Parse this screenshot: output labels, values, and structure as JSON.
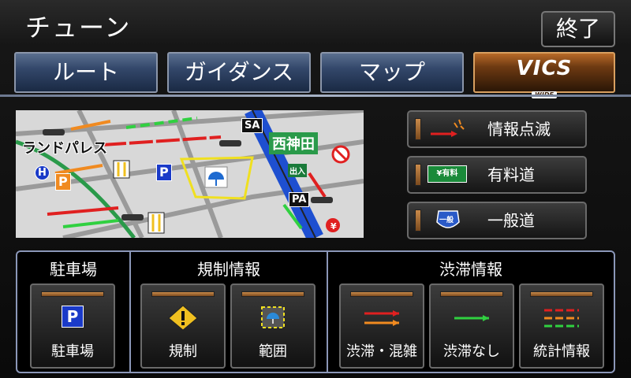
{
  "header": {
    "title": "チューン",
    "exit_label": "終了"
  },
  "tabs": [
    {
      "label": "ルート"
    },
    {
      "label": "ガイダンス"
    },
    {
      "label": "マップ"
    },
    {
      "label": "VICS",
      "sublabel": "WIDE",
      "active": true
    }
  ],
  "map": {
    "labels": {
      "landmark": "ランドパレス",
      "place": "西神田",
      "sa": "SA",
      "pa": "PA",
      "exit_sign": "出入",
      "parking": "P",
      "hospital": "H",
      "yen": "¥"
    }
  },
  "side_buttons": [
    {
      "label": "情報点滅",
      "icon": "flash-info-icon"
    },
    {
      "label": "有料道",
      "icon": "toll-road-icon",
      "badge": "¥有料"
    },
    {
      "label": "一般道",
      "icon": "general-road-icon",
      "badge": "一般"
    }
  ],
  "panel": {
    "groups": [
      {
        "title": "駐車場",
        "buttons": [
          {
            "label": "駐車場",
            "icon": "parking-icon",
            "sign": "P"
          }
        ]
      },
      {
        "title": "規制情報",
        "buttons": [
          {
            "label": "規制",
            "icon": "regulation-warning-icon"
          },
          {
            "label": "範囲",
            "icon": "area-icon"
          }
        ]
      },
      {
        "title": "渋滞情報",
        "buttons": [
          {
            "label": "渋滞・混雑",
            "icon": "congestion-arrows-icon"
          },
          {
            "label": "渋滞なし",
            "icon": "no-congestion-arrow-icon"
          },
          {
            "label": "統計情報",
            "icon": "statistics-lines-icon"
          }
        ]
      }
    ]
  },
  "colors": {
    "congestion_red": "#e02020",
    "congestion_orange": "#f08a20",
    "clear_green": "#30d040",
    "tab_active": "#8a4a18",
    "tab_inactive": "#33476a"
  }
}
